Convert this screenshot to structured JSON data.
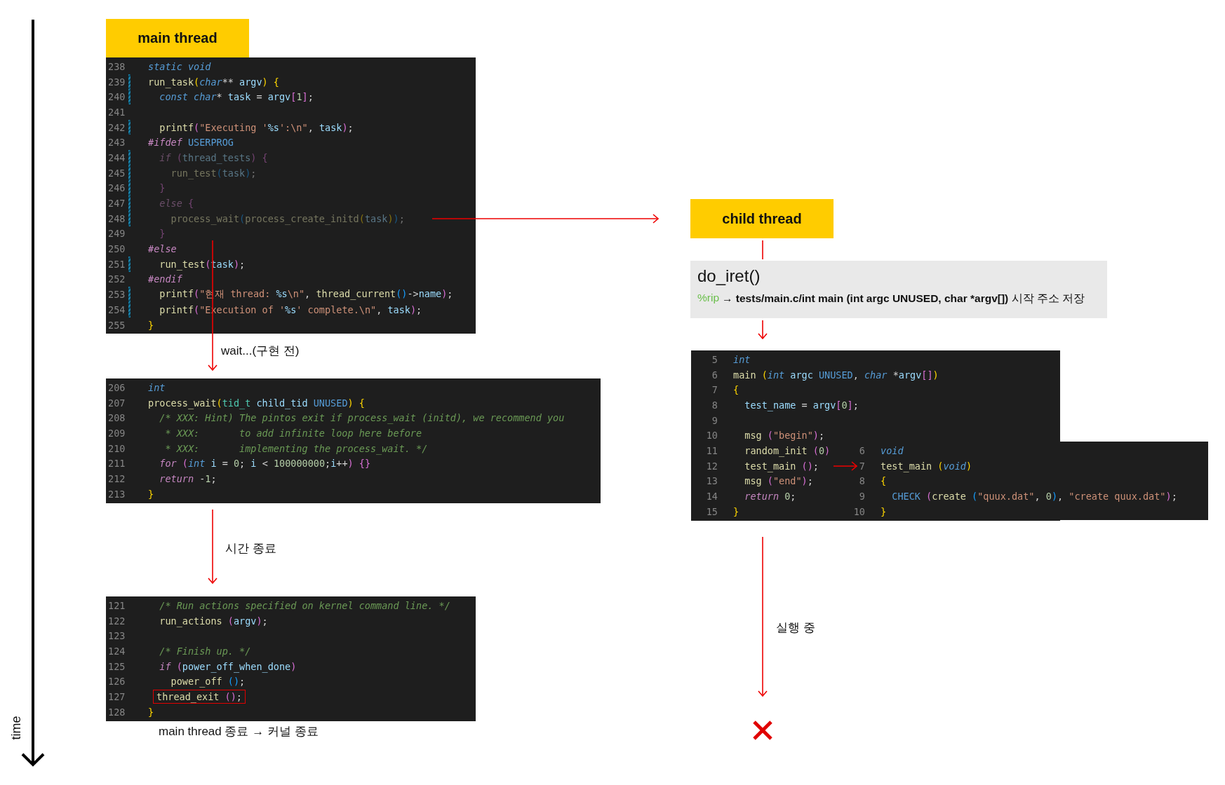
{
  "time_axis": {
    "label": "time"
  },
  "main_label": "main thread",
  "main_code": {
    "lines": [
      {
        "n": "238",
        "modified": false,
        "inactive": false,
        "tokens": [
          {
            "kind": "kw",
            "text": "static void"
          }
        ]
      },
      {
        "n": "239",
        "modified": true,
        "inactive": false,
        "tokens": [
          {
            "kind": "fn",
            "text": "run_task"
          },
          {
            "kind": "br1",
            "text": "("
          },
          {
            "kind": "kw",
            "text": "char"
          },
          {
            "kind": "punc",
            "text": "** "
          },
          {
            "kind": "var",
            "text": "argv"
          },
          {
            "kind": "br1",
            "text": ")"
          },
          {
            "kind": "br1",
            "text": " {"
          }
        ]
      },
      {
        "n": "240",
        "modified": true,
        "inactive": false,
        "tokens": [
          {
            "kind": "kw",
            "text": "  const char"
          },
          {
            "kind": "punc",
            "text": "* "
          },
          {
            "kind": "var",
            "text": "task"
          },
          {
            "kind": "punc",
            "text": " = "
          },
          {
            "kind": "var",
            "text": "argv"
          },
          {
            "kind": "br2",
            "text": "["
          },
          {
            "kind": "num",
            "text": "1"
          },
          {
            "kind": "br2",
            "text": "]"
          },
          {
            "kind": "punc",
            "text": ";"
          }
        ]
      },
      {
        "n": "241",
        "modified": false,
        "inactive": false
      },
      {
        "n": "242",
        "modified": true,
        "inactive": false,
        "tokens": [
          {
            "kind": "fn",
            "text": "  printf"
          },
          {
            "kind": "br2",
            "text": "("
          },
          {
            "kind": "str",
            "text": "\"Executing '"
          },
          {
            "kind": "fmt",
            "text": "%s"
          },
          {
            "kind": "str",
            "text": "':\\n\""
          },
          {
            "kind": "punc",
            "text": ", "
          },
          {
            "kind": "var",
            "text": "task"
          },
          {
            "kind": "br2",
            "text": ")"
          },
          {
            "kind": "punc",
            "text": ";"
          }
        ]
      },
      {
        "n": "243",
        "modified": false,
        "inactive": false,
        "tokens": [
          {
            "kind": "ctl",
            "text": "#ifdef"
          },
          {
            "kind": "macro",
            "text": " USERPROG"
          }
        ]
      },
      {
        "n": "244",
        "modified": true,
        "inactive": true,
        "tokens": [
          {
            "kind": "ctl",
            "text": "  if"
          },
          {
            "kind": "br2",
            "text": " ("
          },
          {
            "kind": "var",
            "text": "thread_tests"
          },
          {
            "kind": "br2",
            "text": ")"
          },
          {
            "kind": "br2",
            "text": " {"
          }
        ]
      },
      {
        "n": "245",
        "modified": true,
        "inactive": true,
        "tokens": [
          {
            "kind": "fn",
            "text": "    run_test"
          },
          {
            "kind": "br3",
            "text": "("
          },
          {
            "kind": "var",
            "text": "task"
          },
          {
            "kind": "br3",
            "text": ")"
          },
          {
            "kind": "punc",
            "text": ";"
          }
        ]
      },
      {
        "n": "246",
        "modified": true,
        "inactive": true,
        "tokens": [
          {
            "kind": "br2",
            "text": "  }"
          }
        ]
      },
      {
        "n": "247",
        "modified": true,
        "inactive": true,
        "tokens": [
          {
            "kind": "ctl",
            "text": "  else"
          },
          {
            "kind": "br2",
            "text": " {"
          }
        ]
      },
      {
        "n": "248",
        "modified": true,
        "inactive": true,
        "tokens": [
          {
            "kind": "fn",
            "text": "    process_wait"
          },
          {
            "kind": "br3",
            "text": "("
          },
          {
            "kind": "fn",
            "text": "process_create_initd"
          },
          {
            "kind": "br1",
            "text": "("
          },
          {
            "kind": "var",
            "text": "task"
          },
          {
            "kind": "br1",
            "text": ")"
          },
          {
            "kind": "br3",
            "text": ")"
          },
          {
            "kind": "punc",
            "text": ";"
          }
        ]
      },
      {
        "n": "249",
        "modified": false,
        "inactive": true,
        "tokens": [
          {
            "kind": "br2",
            "text": "  }"
          }
        ]
      },
      {
        "n": "250",
        "modified": false,
        "inactive": false,
        "tokens": [
          {
            "kind": "ctl",
            "text": "#else"
          }
        ]
      },
      {
        "n": "251",
        "modified": true,
        "inactive": false,
        "tokens": [
          {
            "kind": "fn",
            "text": "  run_test"
          },
          {
            "kind": "br2",
            "text": "("
          },
          {
            "kind": "var",
            "text": "task"
          },
          {
            "kind": "br2",
            "text": ")"
          },
          {
            "kind": "punc",
            "text": ";"
          }
        ]
      },
      {
        "n": "252",
        "modified": false,
        "inactive": false,
        "tokens": [
          {
            "kind": "ctl",
            "text": "#endif"
          }
        ]
      },
      {
        "n": "253",
        "modified": true,
        "inactive": false,
        "tokens": [
          {
            "kind": "fn",
            "text": "  printf"
          },
          {
            "kind": "br2",
            "text": "("
          },
          {
            "kind": "str",
            "text": "\"현재 thread: "
          },
          {
            "kind": "fmt",
            "text": "%s"
          },
          {
            "kind": "str",
            "text": "\\n\""
          },
          {
            "kind": "punc",
            "text": ", "
          },
          {
            "kind": "fn",
            "text": "thread_current"
          },
          {
            "kind": "br3",
            "text": "()"
          },
          {
            "kind": "punc",
            "text": "->"
          },
          {
            "kind": "var",
            "text": "name"
          },
          {
            "kind": "br2",
            "text": ")"
          },
          {
            "kind": "punc",
            "text": ";"
          }
        ]
      },
      {
        "n": "254",
        "modified": true,
        "inactive": false,
        "tokens": [
          {
            "kind": "fn",
            "text": "  printf"
          },
          {
            "kind": "br2",
            "text": "("
          },
          {
            "kind": "str",
            "text": "\"Execution of '"
          },
          {
            "kind": "fmt",
            "text": "%s"
          },
          {
            "kind": "str",
            "text": "' complete.\\n\""
          },
          {
            "kind": "punc",
            "text": ", "
          },
          {
            "kind": "var",
            "text": "task"
          },
          {
            "kind": "br2",
            "text": ")"
          },
          {
            "kind": "punc",
            "text": ";"
          }
        ]
      },
      {
        "n": "255",
        "modified": false,
        "inactive": false,
        "tokens": [
          {
            "kind": "br1",
            "text": "}"
          }
        ]
      }
    ]
  },
  "wait_note": "wait...(구현 전)",
  "wait_code": {
    "lines": [
      {
        "n": "206",
        "tokens": [
          {
            "kind": "kw",
            "text": "int"
          }
        ]
      },
      {
        "n": "207",
        "tokens": [
          {
            "kind": "fn",
            "text": "process_wait"
          },
          {
            "kind": "br1",
            "text": "("
          },
          {
            "kind": "type",
            "text": "tid_t"
          },
          {
            "kind": "var",
            "text": " child_tid"
          },
          {
            "kind": "macro",
            "text": " UNUSED"
          },
          {
            "kind": "br1",
            "text": ")"
          },
          {
            "kind": "br1",
            "text": " {"
          }
        ]
      },
      {
        "n": "208",
        "tokens": [
          {
            "kind": "com",
            "text": "  /* XXX: Hint) The pintos exit if process_wait (initd), we recommend you"
          }
        ]
      },
      {
        "n": "209",
        "tokens": [
          {
            "kind": "com",
            "text": "   * XXX:       to add infinite loop here before"
          }
        ]
      },
      {
        "n": "210",
        "tokens": [
          {
            "kind": "com",
            "text": "   * XXX:       implementing the process_wait. */"
          }
        ]
      },
      {
        "n": "211",
        "tokens": [
          {
            "kind": "ctl",
            "text": "  for"
          },
          {
            "kind": "br2",
            "text": " ("
          },
          {
            "kind": "kw",
            "text": "int"
          },
          {
            "kind": "var",
            "text": " i"
          },
          {
            "kind": "punc",
            "text": " = "
          },
          {
            "kind": "num",
            "text": "0"
          },
          {
            "kind": "punc",
            "text": "; "
          },
          {
            "kind": "var",
            "text": "i"
          },
          {
            "kind": "punc",
            "text": " < "
          },
          {
            "kind": "num",
            "text": "100000000"
          },
          {
            "kind": "punc",
            "text": ";"
          },
          {
            "kind": "var",
            "text": "i"
          },
          {
            "kind": "punc",
            "text": "++"
          },
          {
            "kind": "br2",
            "text": ")"
          },
          {
            "kind": "br2",
            "text": " {}"
          }
        ]
      },
      {
        "n": "212",
        "tokens": [
          {
            "kind": "ctl",
            "text": "  return"
          },
          {
            "kind": "punc",
            "text": " -"
          },
          {
            "kind": "num",
            "text": "1"
          },
          {
            "kind": "punc",
            "text": ";"
          }
        ]
      },
      {
        "n": "213",
        "tokens": [
          {
            "kind": "br1",
            "text": "}"
          }
        ]
      }
    ]
  },
  "timeout_note": "시간 종료",
  "exit_code": {
    "lines": [
      {
        "n": "121",
        "boxed": false,
        "tokens": [
          {
            "kind": "com",
            "text": "  /* Run actions specified on kernel command line. */"
          }
        ]
      },
      {
        "n": "122",
        "boxed": false,
        "tokens": [
          {
            "kind": "fn",
            "text": "  run_actions"
          },
          {
            "kind": "br2",
            "text": " ("
          },
          {
            "kind": "var",
            "text": "argv"
          },
          {
            "kind": "br2",
            "text": ")"
          },
          {
            "kind": "punc",
            "text": ";"
          }
        ]
      },
      {
        "n": "123",
        "boxed": false
      },
      {
        "n": "124",
        "boxed": false,
        "tokens": [
          {
            "kind": "com",
            "text": "  /* Finish up. */"
          }
        ]
      },
      {
        "n": "125",
        "boxed": false,
        "tokens": [
          {
            "kind": "ctl",
            "text": "  if"
          },
          {
            "kind": "br2",
            "text": " ("
          },
          {
            "kind": "var",
            "text": "power_off_when_done"
          },
          {
            "kind": "br2",
            "text": ")"
          }
        ]
      },
      {
        "n": "126",
        "boxed": false,
        "tokens": [
          {
            "kind": "fn",
            "text": "    power_off"
          },
          {
            "kind": "br3",
            "text": " ()"
          },
          {
            "kind": "punc",
            "text": ";"
          }
        ]
      },
      {
        "n": "127",
        "boxed": true,
        "tokens": [
          {
            "kind": "fn",
            "text": "thread_exit"
          },
          {
            "kind": "br2",
            "text": " ()"
          },
          {
            "kind": "punc",
            "text": ";"
          }
        ]
      },
      {
        "n": "128",
        "boxed": false,
        "tokens": [
          {
            "kind": "br1",
            "text": "}"
          }
        ]
      }
    ]
  },
  "exit_note": "main thread 종료 → 커널 종료",
  "child_label": "child thread",
  "do_iret": {
    "title": "do_iret()",
    "register": "%rip",
    "description": "→ **tests/main.c/int main (int argc UNUSED, char *argv[])** 시작 주소 저장"
  },
  "child_main_code": {
    "lines": [
      {
        "n": "5",
        "tokens": [
          {
            "kind": "kw",
            "text": "int"
          }
        ]
      },
      {
        "n": "6",
        "tokens": [
          {
            "kind": "fn",
            "text": "main"
          },
          {
            "kind": "br1",
            "text": " ("
          },
          {
            "kind": "kw",
            "text": "int"
          },
          {
            "kind": "var",
            "text": " argc"
          },
          {
            "kind": "macro",
            "text": " UNUSED"
          },
          {
            "kind": "punc",
            "text": ", "
          },
          {
            "kind": "kw",
            "text": "char"
          },
          {
            "kind": "punc",
            "text": " *"
          },
          {
            "kind": "var",
            "text": "argv"
          },
          {
            "kind": "br2",
            "text": "[]"
          },
          {
            "kind": "br1",
            "text": ")"
          }
        ]
      },
      {
        "n": "7",
        "tokens": [
          {
            "kind": "br1",
            "text": "{"
          }
        ]
      },
      {
        "n": "8",
        "tokens": [
          {
            "kind": "var",
            "text": "  test_name"
          },
          {
            "kind": "punc",
            "text": " = "
          },
          {
            "kind": "var",
            "text": "argv"
          },
          {
            "kind": "br2",
            "text": "["
          },
          {
            "kind": "num",
            "text": "0"
          },
          {
            "kind": "br2",
            "text": "]"
          },
          {
            "kind": "punc",
            "text": ";"
          }
        ]
      },
      {
        "n": "9"
      },
      {
        "n": "10",
        "tokens": [
          {
            "kind": "fn",
            "text": "  msg"
          },
          {
            "kind": "br2",
            "text": " ("
          },
          {
            "kind": "str",
            "text": "\"begin\""
          },
          {
            "kind": "br2",
            "text": ")"
          },
          {
            "kind": "punc",
            "text": ";"
          }
        ]
      },
      {
        "n": "11",
        "tokens": [
          {
            "kind": "fn",
            "text": "  random_init"
          },
          {
            "kind": "br2",
            "text": " ("
          },
          {
            "kind": "num",
            "text": "0"
          },
          {
            "kind": "br2",
            "text": ")"
          }
        ]
      },
      {
        "n": "12",
        "tokens": [
          {
            "kind": "fn",
            "text": "  test_main"
          },
          {
            "kind": "br2",
            "text": " ()"
          },
          {
            "kind": "punc",
            "text": ";"
          }
        ]
      },
      {
        "n": "13",
        "tokens": [
          {
            "kind": "fn",
            "text": "  msg"
          },
          {
            "kind": "br2",
            "text": " ("
          },
          {
            "kind": "str",
            "text": "\"end\""
          },
          {
            "kind": "br2",
            "text": ")"
          },
          {
            "kind": "punc",
            "text": ";"
          }
        ]
      },
      {
        "n": "14",
        "tokens": [
          {
            "kind": "ctl",
            "text": "  return"
          },
          {
            "kind": "num",
            "text": " 0"
          },
          {
            "kind": "punc",
            "text": ";"
          }
        ]
      },
      {
        "n": "15",
        "tokens": [
          {
            "kind": "br1",
            "text": "}"
          }
        ]
      }
    ]
  },
  "test_main_code": {
    "lines": [
      {
        "n": "6",
        "tokens": [
          {
            "kind": "kw",
            "text": "void"
          }
        ]
      },
      {
        "n": "7",
        "tokens": [
          {
            "kind": "fn",
            "text": "test_main"
          },
          {
            "kind": "br1",
            "text": " ("
          },
          {
            "kind": "kw",
            "text": "void"
          },
          {
            "kind": "br1",
            "text": ")"
          }
        ]
      },
      {
        "n": "8",
        "tokens": [
          {
            "kind": "br1",
            "text": "{"
          }
        ]
      },
      {
        "n": "9",
        "tokens": [
          {
            "kind": "macro",
            "text": "  CHECK"
          },
          {
            "kind": "br2",
            "text": " ("
          },
          {
            "kind": "fn",
            "text": "create"
          },
          {
            "kind": "br3",
            "text": " ("
          },
          {
            "kind": "str",
            "text": "\"quux.dat\""
          },
          {
            "kind": "punc",
            "text": ", "
          },
          {
            "kind": "num",
            "text": "0"
          },
          {
            "kind": "br3",
            "text": ")"
          },
          {
            "kind": "punc",
            "text": ", "
          },
          {
            "kind": "str",
            "text": "\"create quux.dat\""
          },
          {
            "kind": "br2",
            "text": ")"
          },
          {
            "kind": "punc",
            "text": ";"
          }
        ]
      },
      {
        "n": "10",
        "tokens": [
          {
            "kind": "br1",
            "text": "}"
          }
        ]
      }
    ]
  },
  "running_note": "실행 중"
}
